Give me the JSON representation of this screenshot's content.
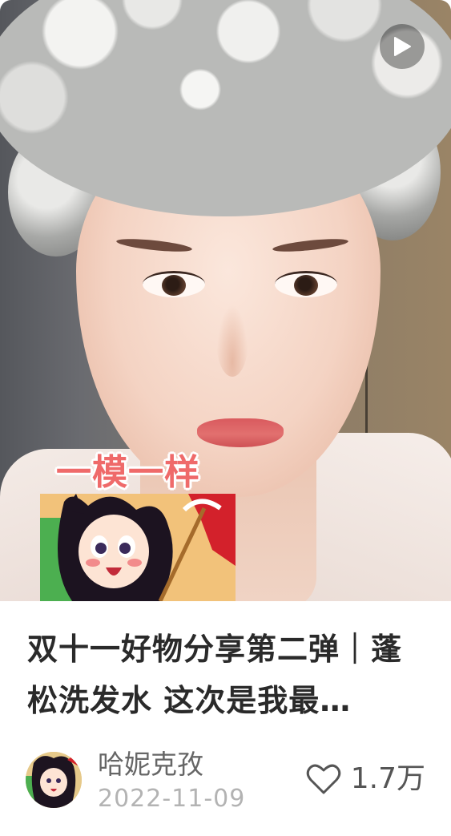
{
  "post": {
    "title": "双十一好物分享第二弹｜蓬松洗发水 这次是我最…",
    "sticker_text": "一模一样",
    "author": "哈妮克孜",
    "date": "2022-11-09",
    "likes": "1.7万"
  },
  "icons": {
    "play": "play-icon",
    "like": "heart-icon"
  },
  "colors": {
    "sticker": "#ef6a6a",
    "title": "#2a2a2a",
    "author": "#666666",
    "date": "#b3b3b3"
  }
}
